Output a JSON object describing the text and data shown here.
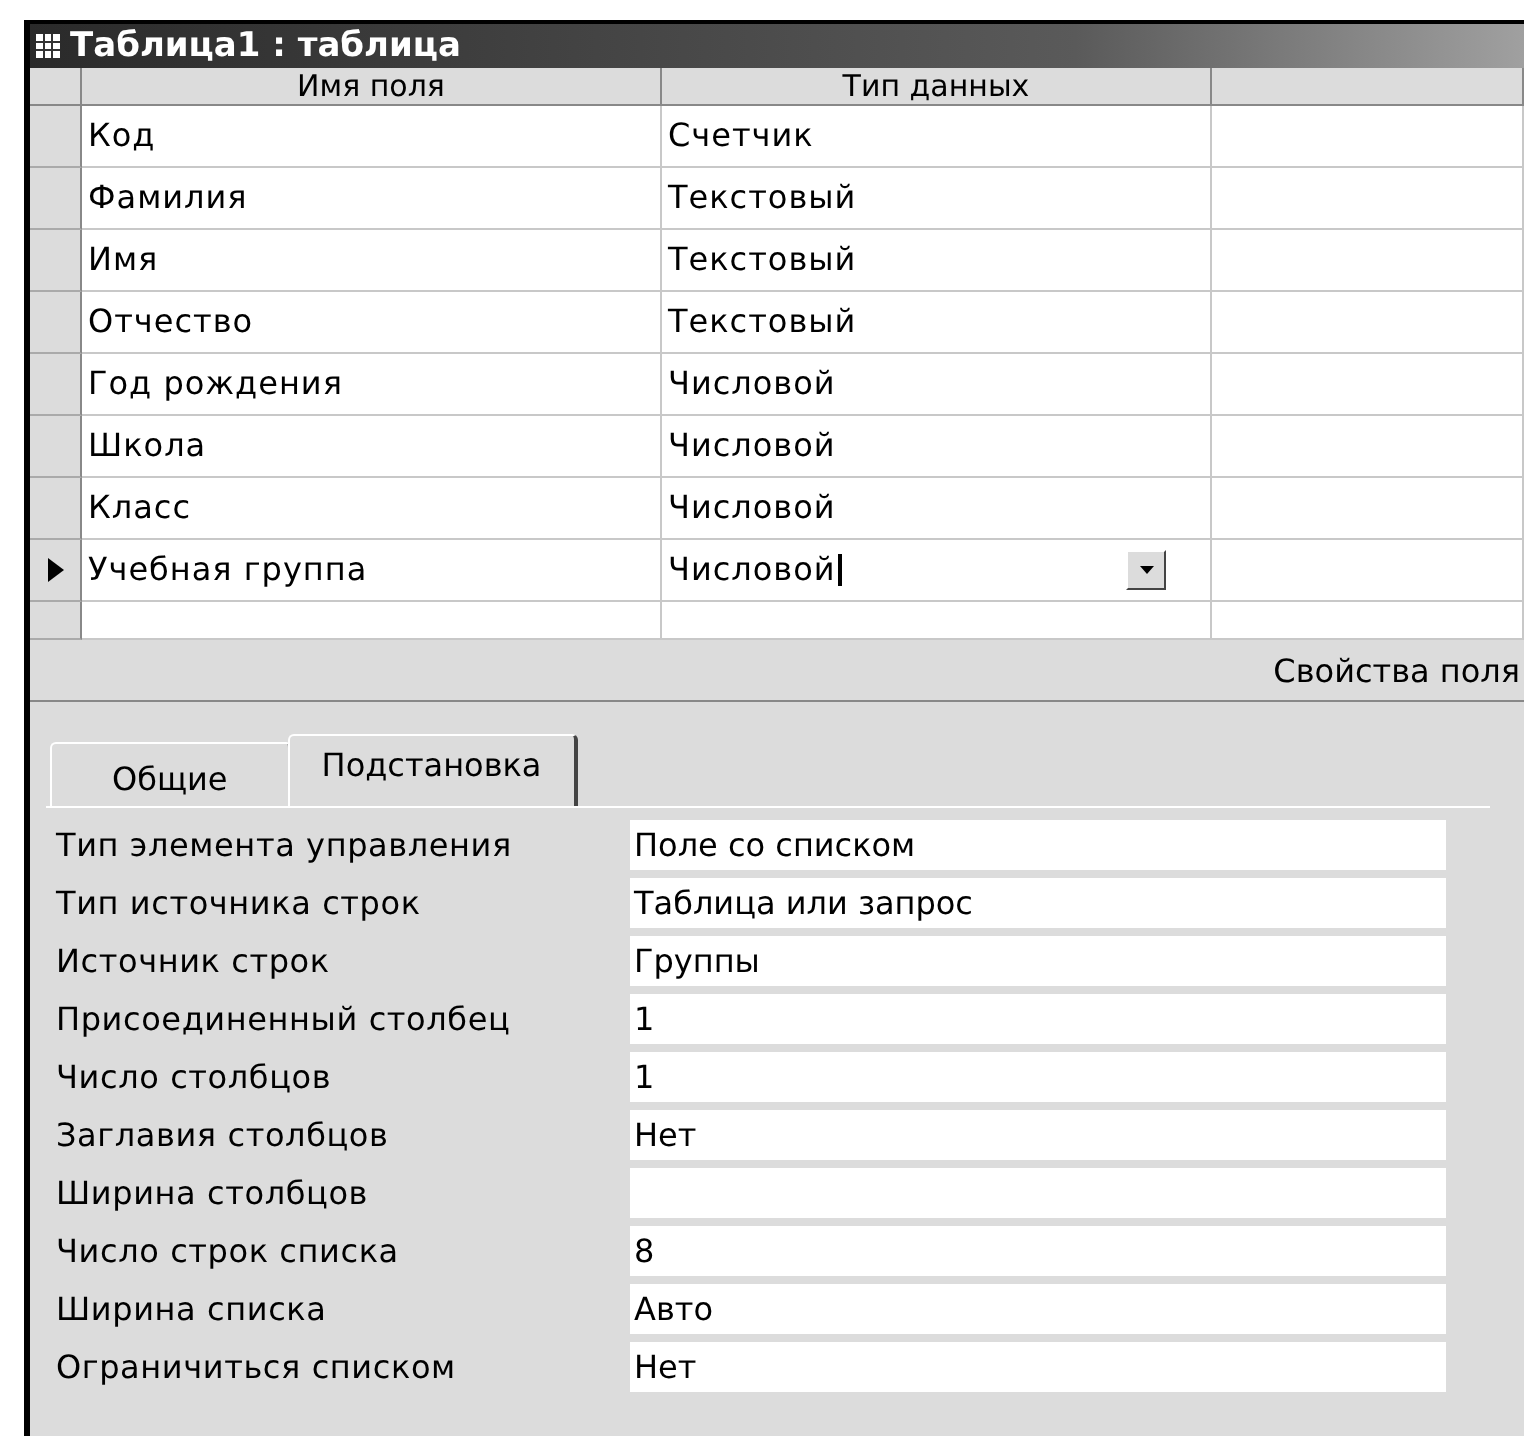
{
  "window": {
    "title": "Таблица1 : таблица"
  },
  "grid": {
    "columns": [
      "Имя поля",
      "Тип данных"
    ],
    "rows": [
      {
        "name": "Код",
        "type": "Счетчик",
        "current": false
      },
      {
        "name": "Фамилия",
        "type": "Текстовый",
        "current": false
      },
      {
        "name": "Имя",
        "type": "Текстовый",
        "current": false
      },
      {
        "name": "Отчество",
        "type": "Текстовый",
        "current": false
      },
      {
        "name": "Год рождения",
        "type": "Числовой",
        "current": false
      },
      {
        "name": "Школа",
        "type": "Числовой",
        "current": false
      },
      {
        "name": "Класс",
        "type": "Числовой",
        "current": false
      },
      {
        "name": "Учебная группа",
        "type": "Числовой",
        "current": true
      }
    ]
  },
  "properties_caption": "Свойства поля",
  "tabs": [
    {
      "label": "Общие",
      "selected": false
    },
    {
      "label": "Подстановка",
      "selected": true
    }
  ],
  "properties": [
    {
      "label": "Тип элемента управления",
      "value": "Поле со списком"
    },
    {
      "label": "Тип источника строк",
      "value": "Таблица или запрос"
    },
    {
      "label": "Источник строк",
      "value": "Группы"
    },
    {
      "label": "Присоединенный столбец",
      "value": "1"
    },
    {
      "label": "Число столбцов",
      "value": "1"
    },
    {
      "label": "Заглавия столбцов",
      "value": "Нет"
    },
    {
      "label": "Ширина столбцов"
    },
    {
      "label": "Число строк списка",
      "value": "8"
    },
    {
      "label": "Ширина списка",
      "value": "Авто"
    },
    {
      "label": "Ограничиться списком",
      "value": "Нет"
    }
  ]
}
